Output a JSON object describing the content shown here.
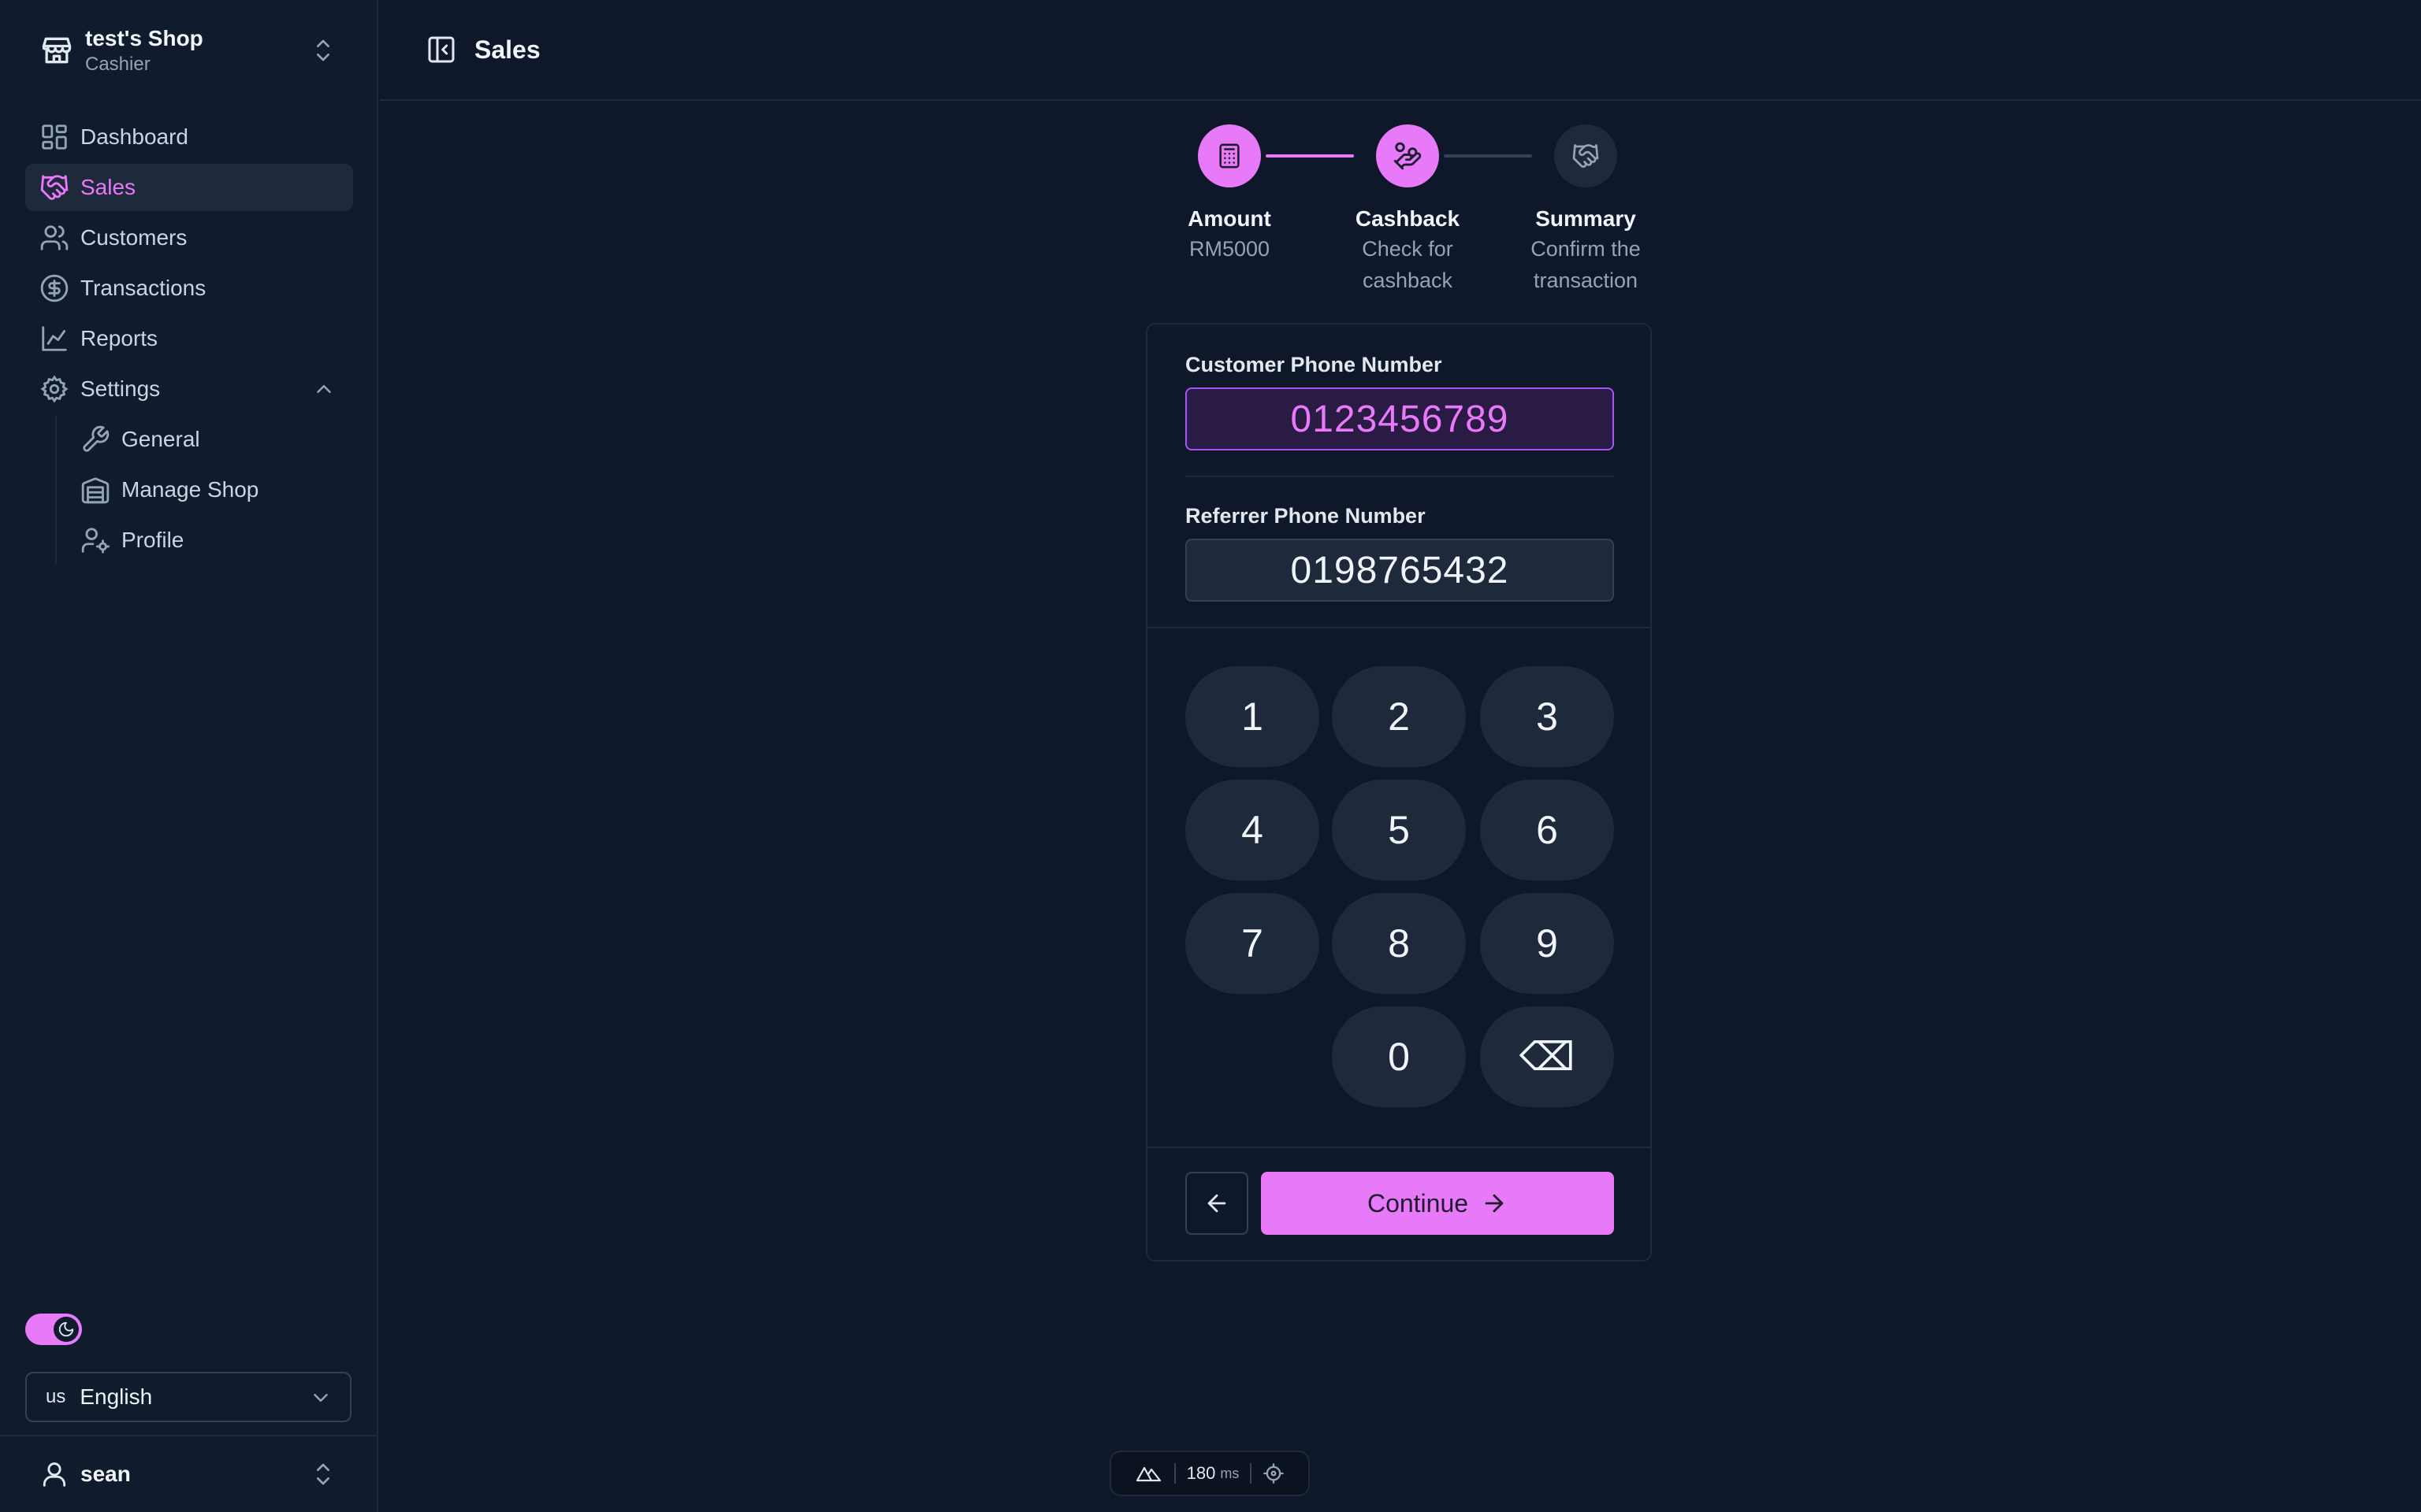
{
  "shop": {
    "name": "test's Shop",
    "role": "Cashier"
  },
  "sidebar": {
    "items": [
      {
        "label": "Dashboard",
        "icon": "dashboard-icon"
      },
      {
        "label": "Sales",
        "icon": "handshake-icon",
        "active": true
      },
      {
        "label": "Customers",
        "icon": "users-icon"
      },
      {
        "label": "Transactions",
        "icon": "dollar-circle-icon"
      },
      {
        "label": "Reports",
        "icon": "line-chart-icon"
      },
      {
        "label": "Settings",
        "icon": "gear-icon",
        "expanded": true
      }
    ],
    "settings_items": [
      {
        "label": "General",
        "icon": "wrench-icon"
      },
      {
        "label": "Manage Shop",
        "icon": "warehouse-icon"
      },
      {
        "label": "Profile",
        "icon": "user-cog-icon"
      }
    ]
  },
  "language": {
    "code": "us",
    "label": "English"
  },
  "user": {
    "name": "sean"
  },
  "header": {
    "title": "Sales"
  },
  "steps": [
    {
      "title": "Amount",
      "desc": "RM5000",
      "state": "done",
      "icon": "calculator-icon"
    },
    {
      "title": "Cashback",
      "desc": "Check for cashback",
      "state": "current",
      "icon": "hand-coins-icon"
    },
    {
      "title": "Summary",
      "desc": "Confirm the transaction",
      "state": "todo",
      "icon": "handshake-icon"
    }
  ],
  "form": {
    "customer_label": "Customer Phone Number",
    "customer_value": "0123456789",
    "referrer_label": "Referrer Phone Number",
    "referrer_value": "0198765432"
  },
  "keypad": {
    "keys": [
      "1",
      "2",
      "3",
      "4",
      "5",
      "6",
      "7",
      "8",
      "9",
      "0"
    ],
    "backspace": "⌫"
  },
  "actions": {
    "continue_label": "Continue"
  },
  "devbar": {
    "time": "180",
    "unit": "ms"
  },
  "colors": {
    "accent": "#e879f9",
    "background": "#0f172a",
    "sidebar": "#111b2e",
    "muted": "#1e293b"
  }
}
